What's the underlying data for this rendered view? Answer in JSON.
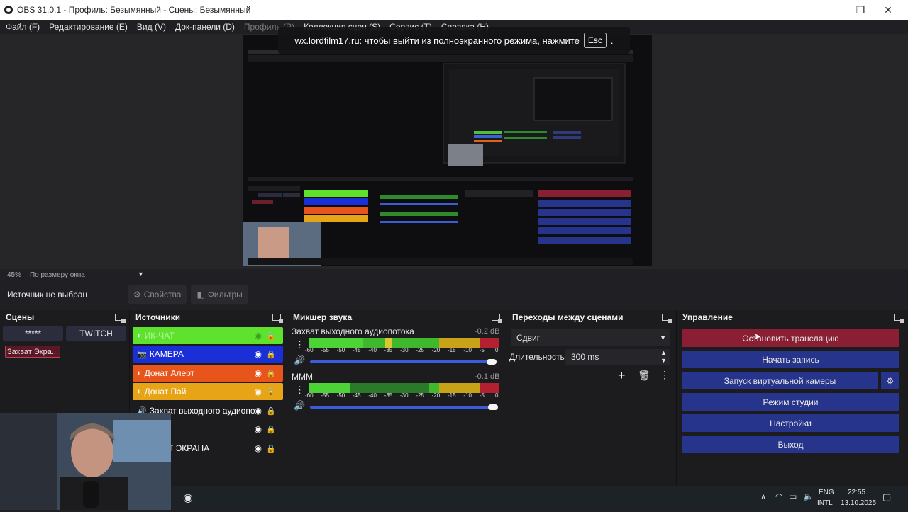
{
  "window": {
    "title": "OBS 31.0.1 - Профиль: Безымянный - Сцены: Безымянный",
    "controls": {
      "minimize": "—",
      "maximize": "❐",
      "close": "✕"
    }
  },
  "menu": [
    {
      "label": "Файл (F)",
      "disabled": false
    },
    {
      "label": "Редактирование (E)",
      "disabled": false
    },
    {
      "label": "Вид (V)",
      "disabled": false
    },
    {
      "label": "Док-панели (D)",
      "disabled": false
    },
    {
      "label": "Профиль (P)",
      "disabled": true
    },
    {
      "label": "Коллекция сцен (S)",
      "disabled": false
    },
    {
      "label": "Сервис (T)",
      "disabled": false
    },
    {
      "label": "Справка (H)",
      "disabled": false
    }
  ],
  "fullscreen_banner": {
    "text": "wx.lordfilm17.ru: чтобы выйти из полноэкранного режима, нажмите",
    "key": "Esc",
    "suffix": "."
  },
  "preview": {
    "zoom": "45%",
    "zoom_mode": "По размеру окна"
  },
  "source_bar": {
    "status": "Источник не выбран",
    "properties": "Свойства",
    "filters": "Фильтры"
  },
  "scenes": {
    "title": "Сцены",
    "items": [
      "*****",
      "TWITCH",
      "Захват Экра..."
    ]
  },
  "sources": {
    "title": "Источники",
    "items": [
      {
        "label": "ИК-ЧАТ",
        "color": "#5ee22e",
        "icon": "globe-icon"
      },
      {
        "label": "КАМЕРА",
        "color": "#1a2fd6",
        "icon": "camera-icon"
      },
      {
        "label": "Донат Алерт",
        "color": "#e8551a",
        "icon": "globe-icon"
      },
      {
        "label": "Донат Пай",
        "color": "#e8a417",
        "icon": "globe-icon"
      },
      {
        "label": "Захват выходного аудиопот",
        "color": "",
        "icon": "speaker-icon"
      },
      {
        "label": "",
        "color": "",
        "icon": ""
      },
      {
        "label": "Т ЭКРАНА",
        "color": "",
        "icon": ""
      }
    ]
  },
  "mixer": {
    "title": "Микшер звука",
    "ticks": [
      "-60",
      "-55",
      "-50",
      "-45",
      "-40",
      "-35",
      "-30",
      "-25",
      "-20",
      "-15",
      "-10",
      "-5",
      "0"
    ],
    "channels": [
      {
        "name": "Захват выходного аудиопотока",
        "db": "-0.2 dB",
        "level": 0.99
      },
      {
        "name": "МММ",
        "db": "-0.1 dB",
        "level": 0.99
      }
    ]
  },
  "transitions": {
    "title": "Переходы между сценами",
    "selected": "Сдвиг",
    "duration_label": "Длительность",
    "duration_value": "300 ms"
  },
  "controls": {
    "title": "Управление",
    "buttons": [
      {
        "label": "Остановить трансляцию",
        "color": "#8a1f34"
      },
      {
        "label": "Начать запись",
        "color": "#27348c"
      },
      {
        "label": "Запуск виртуальной камеры",
        "color": "#27348c"
      },
      {
        "label": "Режим студии",
        "color": "#27348c"
      },
      {
        "label": "Настройки",
        "color": "#27348c"
      },
      {
        "label": "Выход",
        "color": "#27348c"
      }
    ]
  },
  "taskbar": {
    "lang_top": "ENG",
    "lang_bottom": "INTL",
    "time": "22:55",
    "date": "13.10.2025"
  }
}
